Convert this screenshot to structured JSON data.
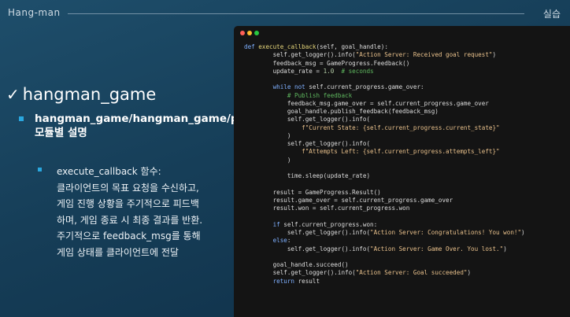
{
  "header": {
    "title": "Hang-man",
    "right_label": "실습"
  },
  "slide": {
    "heading": "hangman_game",
    "level2": "hangman_game/hangman_game/progress_action_server.py 모듈별 설명",
    "level3_lines": [
      "execute_callback 함수:",
      "클라이언트의 목표 요청을 수신하고,",
      "게임 진행 상황을 주기적으로 피드백",
      "하며, 게임 종료 시 최종 결과를 반환.",
      "주기적으로 feedback_msg를 통해",
      "게임 상태를 클라이언트에 전달"
    ]
  },
  "code_window": {
    "lines": [
      [
        {
          "t": "def ",
          "c": "kw"
        },
        {
          "t": "execute_callback",
          "c": "fn"
        },
        {
          "t": "(self, goal_handle):",
          "c": ""
        }
      ],
      [
        {
          "t": "        self.get_logger().info(",
          "c": ""
        },
        {
          "t": "\"Action Server: Received goal request\"",
          "c": "str"
        },
        {
          "t": ")",
          "c": ""
        }
      ],
      [
        {
          "t": "        feedback_msg = GameProgress.Feedback()",
          "c": ""
        }
      ],
      [
        {
          "t": "        update_rate = ",
          "c": ""
        },
        {
          "t": "1.0",
          "c": "num"
        },
        {
          "t": "  ",
          "c": ""
        },
        {
          "t": "# seconds",
          "c": "cm"
        }
      ],
      [
        {
          "t": "",
          "c": ""
        }
      ],
      [
        {
          "t": "        ",
          "c": ""
        },
        {
          "t": "while not ",
          "c": "kw"
        },
        {
          "t": "self.current_progress.game_over:",
          "c": ""
        }
      ],
      [
        {
          "t": "            ",
          "c": ""
        },
        {
          "t": "# Publish feedback",
          "c": "cm"
        }
      ],
      [
        {
          "t": "            feedback_msg.game_over = self.current_progress.game_over",
          "c": ""
        }
      ],
      [
        {
          "t": "            goal_handle.publish_feedback(feedback_msg)",
          "c": ""
        }
      ],
      [
        {
          "t": "            self.get_logger().info(",
          "c": ""
        }
      ],
      [
        {
          "t": "                ",
          "c": ""
        },
        {
          "t": "f\"Current State: {self.current_progress.current_state}\"",
          "c": "str"
        }
      ],
      [
        {
          "t": "            )",
          "c": ""
        }
      ],
      [
        {
          "t": "            self.get_logger().info(",
          "c": ""
        }
      ],
      [
        {
          "t": "                ",
          "c": ""
        },
        {
          "t": "f\"Attempts Left: {self.current_progress.attempts_left}\"",
          "c": "str"
        }
      ],
      [
        {
          "t": "            )",
          "c": ""
        }
      ],
      [
        {
          "t": "",
          "c": ""
        }
      ],
      [
        {
          "t": "            time.sleep(update_rate)",
          "c": ""
        }
      ],
      [
        {
          "t": "",
          "c": ""
        }
      ],
      [
        {
          "t": "        result = GameProgress.Result()",
          "c": ""
        }
      ],
      [
        {
          "t": "        result.game_over = self.current_progress.game_over",
          "c": ""
        }
      ],
      [
        {
          "t": "        result.won = self.current_progress.won",
          "c": ""
        }
      ],
      [
        {
          "t": "",
          "c": ""
        }
      ],
      [
        {
          "t": "        ",
          "c": ""
        },
        {
          "t": "if ",
          "c": "kw"
        },
        {
          "t": "self.current_progress.won:",
          "c": ""
        }
      ],
      [
        {
          "t": "            self.get_logger().info(",
          "c": ""
        },
        {
          "t": "\"Action Server: Congratulations! You won!\"",
          "c": "str"
        },
        {
          "t": ")",
          "c": ""
        }
      ],
      [
        {
          "t": "        ",
          "c": ""
        },
        {
          "t": "else",
          "c": "kw"
        },
        {
          "t": ":",
          "c": ""
        }
      ],
      [
        {
          "t": "            self.get_logger().info(",
          "c": ""
        },
        {
          "t": "\"Action Server: Game Over. You lost.\"",
          "c": "str"
        },
        {
          "t": ")",
          "c": ""
        }
      ],
      [
        {
          "t": "",
          "c": ""
        }
      ],
      [
        {
          "t": "        goal_handle.succeed()",
          "c": ""
        }
      ],
      [
        {
          "t": "        self.get_logger().info(",
          "c": ""
        },
        {
          "t": "\"Action Server: Goal succeeded\"",
          "c": "str"
        },
        {
          "t": ")",
          "c": ""
        }
      ],
      [
        {
          "t": "        ",
          "c": ""
        },
        {
          "t": "return ",
          "c": "kw"
        },
        {
          "t": "result",
          "c": ""
        }
      ]
    ]
  },
  "icons": {
    "check": "checkmark-icon",
    "bullet": "square-bullet-icon",
    "window_controls": [
      "close-dot-icon",
      "minimize-dot-icon",
      "maximize-dot-icon"
    ]
  },
  "colors": {
    "background": "#1a4560",
    "bullet": "#2aa7df",
    "code_bg": "#141414",
    "keyword": "#7fb0ff",
    "string": "#e8c08b",
    "comment": "#5fb85f"
  }
}
